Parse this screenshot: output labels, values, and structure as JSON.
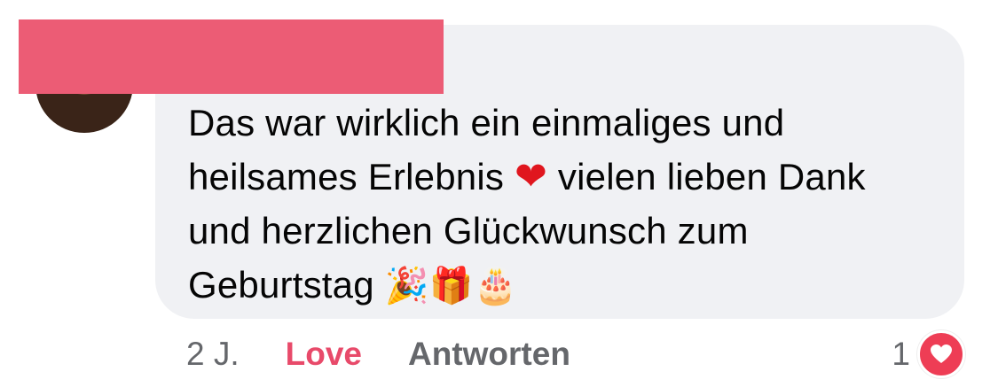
{
  "comment": {
    "text_line1": "Das war wirklich ein einmaliges und",
    "text_line2a": "heilsames Erlebnis",
    "text_line2b": "vielen lieben Dank",
    "text_line3": "und herzlichen Glückwunsch zum",
    "text_line4": "Geburtstag",
    "emojis": {
      "heart": "❤",
      "party": "🎉",
      "gift": "🎁",
      "cake": "🎂"
    }
  },
  "actions": {
    "time": "2 J.",
    "love_label": "Love",
    "reply_label": "Antworten"
  },
  "reactions": {
    "count": "1",
    "icon": "heart-icon"
  },
  "colors": {
    "bubble": "#f0f1f4",
    "love": "#e84a6a",
    "reaction_badge": "#ee3d55",
    "redaction": "#ec5c75"
  }
}
